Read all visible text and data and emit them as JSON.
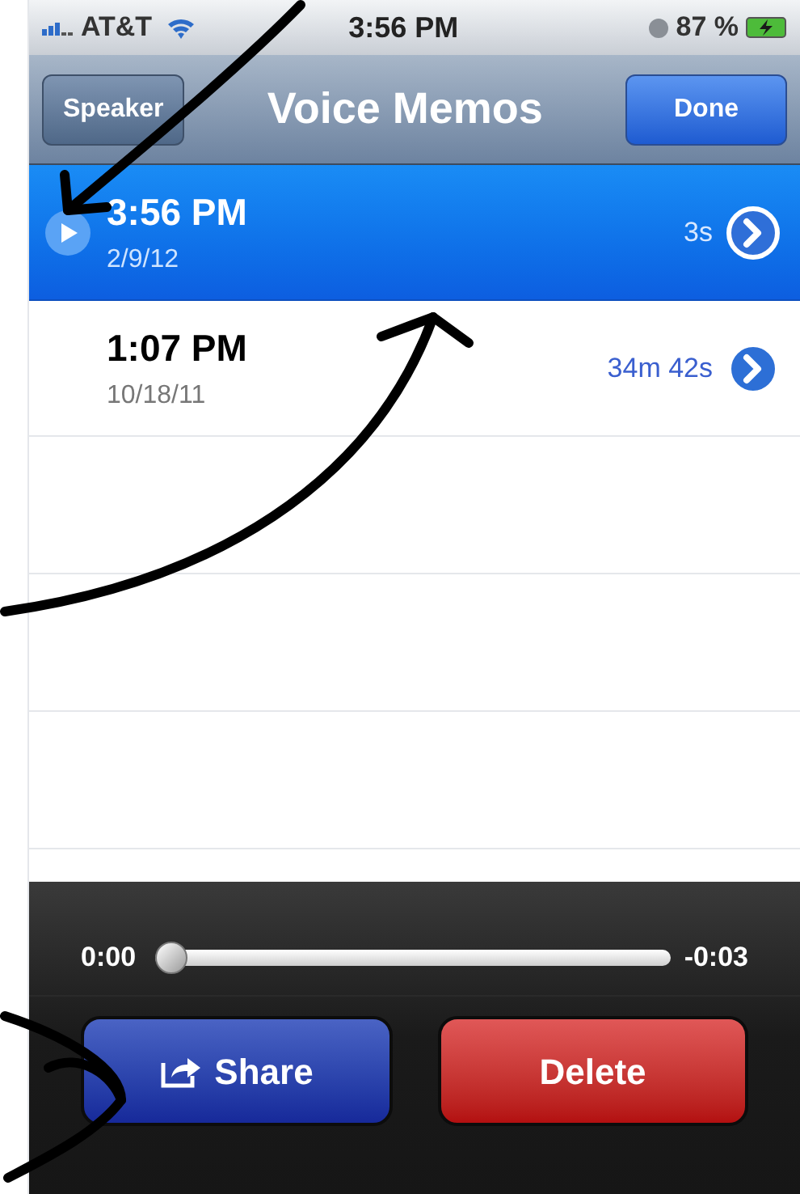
{
  "status_bar": {
    "carrier": "AT&T",
    "time": "3:56 PM",
    "battery": "87 %"
  },
  "nav_bar": {
    "left_button": "Speaker",
    "title": "Voice Memos",
    "right_button": "Done"
  },
  "memos": [
    {
      "time": "3:56 PM",
      "date": "2/9/12",
      "duration": "3s",
      "selected": true
    },
    {
      "time": "1:07 PM",
      "date": "10/18/11",
      "duration": "34m 42s",
      "selected": false
    }
  ],
  "player": {
    "elapsed": "0:00",
    "remaining": "-0:03",
    "level": 0
  },
  "actions": [
    {
      "label": "Share",
      "kind": "share"
    },
    {
      "label": "Delete",
      "kind": "delete"
    }
  ]
}
